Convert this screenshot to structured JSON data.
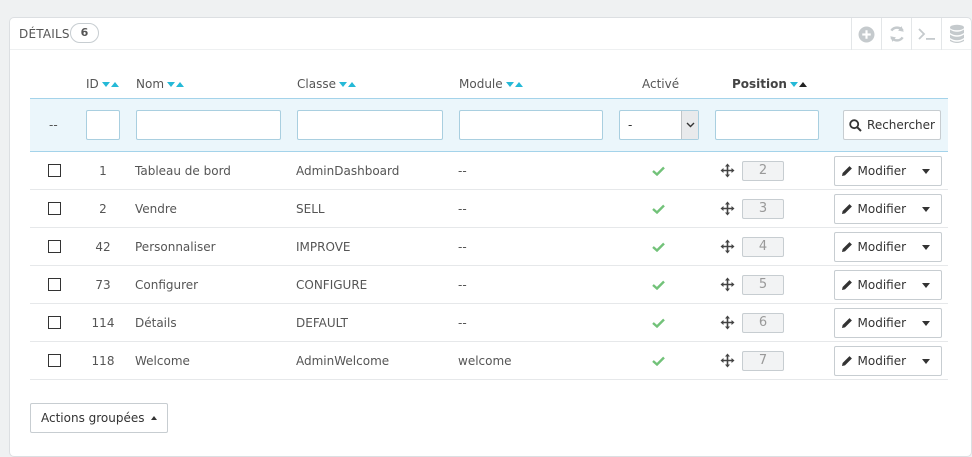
{
  "panel": {
    "title": "DÉTAILS",
    "count": "6",
    "toolbar": [
      "add-icon",
      "refresh-icon",
      "sql-icon",
      "database-icon"
    ]
  },
  "table": {
    "columns": {
      "id": "ID",
      "name": "Nom",
      "class": "Classe",
      "module": "Module",
      "active": "Activé",
      "position": "Position"
    },
    "filter": {
      "dash": "--",
      "active_select": "-",
      "search_button": "Rechercher"
    },
    "rows": [
      {
        "id": "1",
        "name": "Tableau de bord",
        "class": "AdminDashboard",
        "module": "--",
        "position": "2",
        "action": "Modifier"
      },
      {
        "id": "2",
        "name": "Vendre",
        "class": "SELL",
        "module": "--",
        "position": "3",
        "action": "Modifier"
      },
      {
        "id": "42",
        "name": "Personnaliser",
        "class": "IMPROVE",
        "module": "--",
        "position": "4",
        "action": "Modifier"
      },
      {
        "id": "73",
        "name": "Configurer",
        "class": "CONFIGURE",
        "module": "--",
        "position": "5",
        "action": "Modifier"
      },
      {
        "id": "114",
        "name": "Détails",
        "class": "DEFAULT",
        "module": "--",
        "position": "6",
        "action": "Modifier"
      },
      {
        "id": "118",
        "name": "Welcome",
        "class": "AdminWelcome",
        "module": "welcome",
        "position": "7",
        "action": "Modifier"
      }
    ]
  },
  "bulk_actions": "Actions groupées",
  "colors": {
    "accent": "#25b9d7",
    "check": "#72c279",
    "filter_bg": "#ebf6fb"
  }
}
